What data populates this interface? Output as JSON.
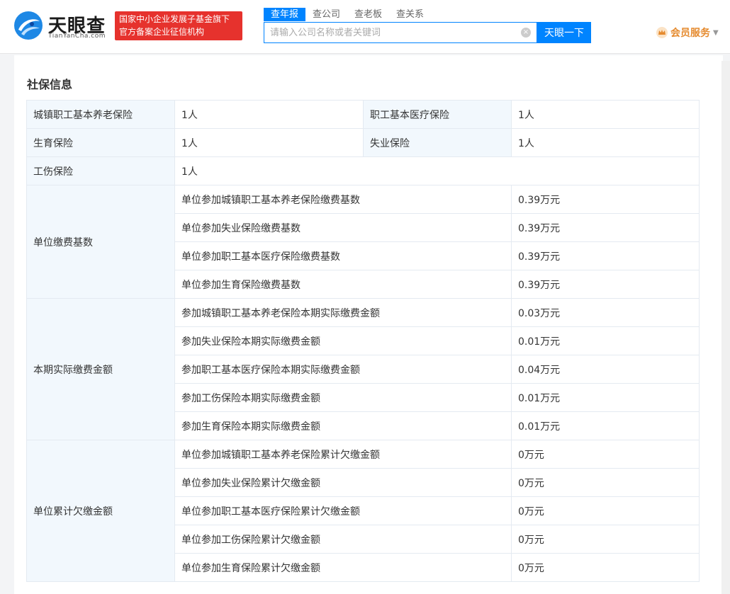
{
  "brand": {
    "name": "天眼查",
    "sub": "TianYanCha.com",
    "badge_line1": "国家中小企业发展子基金旗下",
    "badge_line2": "官方备案企业征信机构"
  },
  "search": {
    "tabs": [
      {
        "label": "查年报",
        "active": true
      },
      {
        "label": "查公司",
        "active": false
      },
      {
        "label": "查老板",
        "active": false
      },
      {
        "label": "查关系",
        "active": false
      }
    ],
    "placeholder": "请输入公司名称或者关键词",
    "button": "天眼一下"
  },
  "vip": {
    "label": "会员服务"
  },
  "section": {
    "title": "社保信息",
    "rows": [
      {
        "l1": "城镇职工基本养老保险",
        "v1": "1人",
        "l2": "职工基本医疗保险",
        "v2": "1人"
      },
      {
        "l1": "生育保险",
        "v1": "1人",
        "l2": "失业保险",
        "v2": "1人"
      },
      {
        "l1": "工伤保险",
        "v1": "1人"
      }
    ],
    "groups": [
      {
        "label": "单位缴费基数",
        "items": [
          {
            "name": "单位参加城镇职工基本养老保险缴费基数",
            "value": "0.39万元"
          },
          {
            "name": "单位参加失业保险缴费基数",
            "value": "0.39万元"
          },
          {
            "name": "单位参加职工基本医疗保险缴费基数",
            "value": "0.39万元"
          },
          {
            "name": "单位参加生育保险缴费基数",
            "value": "0.39万元"
          }
        ]
      },
      {
        "label": "本期实际缴费金额",
        "items": [
          {
            "name": "参加城镇职工基本养老保险本期实际缴费金额",
            "value": "0.03万元"
          },
          {
            "name": "参加失业保险本期实际缴费金额",
            "value": "0.01万元"
          },
          {
            "name": "参加职工基本医疗保险本期实际缴费金额",
            "value": "0.04万元"
          },
          {
            "name": "参加工伤保险本期实际缴费金额",
            "value": "0.01万元"
          },
          {
            "name": "参加生育保险本期实际缴费金额",
            "value": "0.01万元"
          }
        ]
      },
      {
        "label": "单位累计欠缴金额",
        "items": [
          {
            "name": "单位参加城镇职工基本养老保险累计欠缴金额",
            "value": "0万元"
          },
          {
            "name": "单位参加失业保险累计欠缴金额",
            "value": "0万元"
          },
          {
            "name": "单位参加职工基本医疗保险累计欠缴金额",
            "value": "0万元"
          },
          {
            "name": "单位参加工伤保险累计欠缴金额",
            "value": "0万元"
          },
          {
            "name": "单位参加生育保险累计欠缴金额",
            "value": "0万元"
          }
        ]
      }
    ]
  }
}
